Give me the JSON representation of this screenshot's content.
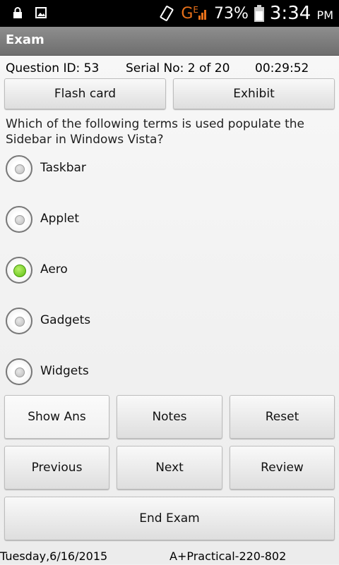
{
  "status_bar": {
    "network": "G",
    "network_sub": "E",
    "battery": "73%",
    "time": "3:34",
    "ampm": "PM"
  },
  "app": {
    "title": "Exam"
  },
  "exam": {
    "question_id": "Question ID: 53",
    "serial": "Serial No: 2 of 20",
    "timer": "00:29:52",
    "flash_card": "Flash card",
    "exhibit": "Exhibit",
    "question": "Which of the following terms is used populate the Sidebar in Windows Vista?",
    "options": [
      {
        "label": "Taskbar",
        "selected": false
      },
      {
        "label": "Applet",
        "selected": false
      },
      {
        "label": "Aero",
        "selected": true
      },
      {
        "label": "Gadgets",
        "selected": false
      },
      {
        "label": "Widgets",
        "selected": false
      }
    ],
    "buttons": {
      "show_ans": "Show Ans",
      "notes": "Notes",
      "reset": "Reset",
      "previous": "Previous",
      "next": "Next",
      "review": "Review",
      "end_exam": "End Exam"
    },
    "footer_date": "Tuesday,6/16/2015",
    "footer_exam": "A+Practical-220-802"
  }
}
